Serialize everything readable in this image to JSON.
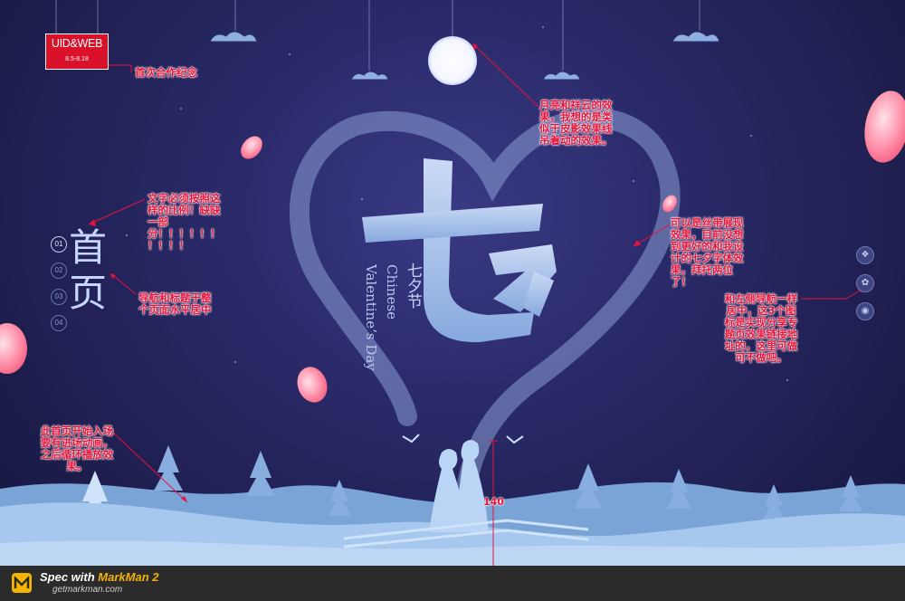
{
  "logo": {
    "brand": "UID&WEB",
    "date": "8.5-8.18"
  },
  "nav": {
    "items": [
      "01",
      "02",
      "03",
      "04"
    ],
    "title": "首页"
  },
  "hero": {
    "big_char": "七夕",
    "subtitle_cn": "七夕节",
    "subtitle_en_1": "Chinese",
    "subtitle_en_2": "Valentine’s Day"
  },
  "share": {
    "icons": [
      "wechat-icon",
      "qq-icon",
      "weibo-icon"
    ]
  },
  "measure": {
    "value": "140"
  },
  "annotations": {
    "logo_note": "首次合作纪念",
    "moon_note": [
      "月亮和祥云的效",
      "果，我想的是类",
      "似于皮影效果线",
      "吊着动的效果。"
    ],
    "text_note": [
      "文字必须按照这",
      "样的比例！缺缺",
      "一部",
      "分！！！！！！",
      "！！！！"
    ],
    "nav_note": [
      "导航和标题于整",
      "个页面水平居中"
    ],
    "calligraphy_note": [
      "可以是丝带展现",
      "效果，目前没想",
      "到更好的和我设",
      "计的七夕字体效",
      "果，拜托两位",
      "了！"
    ],
    "share_note": [
      "和左侧导航一样",
      "居中，这3个图",
      "标是实现分享专",
      "题页效果链接地",
      "址的，这里可做",
      "可不做吧。"
    ],
    "enter_note": [
      "此首页开始入场",
      "要有进场动画，",
      "之后循环播放效",
      "果。"
    ]
  },
  "footer": {
    "spec_prefix": "Spec with ",
    "spec_brand": "MarkMan 2",
    "url": "getmarkman.com"
  },
  "colors": {
    "annotation": "#e8133a",
    "logo_bg": "#d9122a",
    "background": "#1f1f4e",
    "ground": "#9ec4ec"
  }
}
